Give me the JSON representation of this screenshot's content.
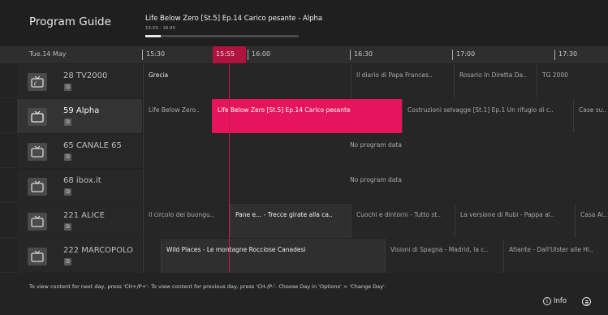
{
  "header": {
    "title": "Program Guide",
    "now_playing": {
      "title": "Life Below Zero [St.5] Ep.14 Carico pesante - Alpha",
      "time": "15:50 - 16:45",
      "progress_percent": 10
    }
  },
  "timebar": {
    "date": "Tue.14 May",
    "ticks": [
      "15:30",
      "16:00",
      "16:30",
      "17:00",
      "17:30"
    ],
    "now": "15:55"
  },
  "channels": [
    {
      "name": "28 TV2000",
      "badge": "D",
      "icon": "tv-icon",
      "programs": [
        "Grecia",
        "Il diario di Papa Frances..",
        "Rosario In Diretta Da..",
        "TG 2000"
      ]
    },
    {
      "name": "59 Alpha",
      "badge": "D",
      "icon": "tv-icon",
      "programs": [
        "Life Below Zero..",
        "Life Below Zero [St.5] Ep.14 Carico pesante",
        "Costruzioni selvagge [St.1] Ep.1 Un rifugio di c..",
        "Case su.."
      ]
    },
    {
      "name": "65 CANALE 65",
      "badge": "D",
      "icon": "tv-icon",
      "programs": [
        "No program data"
      ]
    },
    {
      "name": "68 ibox.it",
      "badge": "D",
      "icon": "tv-icon",
      "programs": [
        "No program data"
      ]
    },
    {
      "name": "221 ALICE",
      "badge": "D",
      "icon": "tv-icon",
      "programs": [
        "Il circolo dei buongu..",
        "Pane e... - Trecce girate alla ca..",
        "Cuochi e dintorni - Tutto st..",
        "La versione di Rubi - Pappa al..",
        "Casa Al.."
      ]
    },
    {
      "name": "222 MARCOPOLO",
      "badge": "D",
      "icon": "tv-icon",
      "programs": [
        "Wild Places - Le montagne Rocciose Canadesi",
        "Visioni di Spagna - Madrid, la c..",
        "Atlante - Dall'Ulster alle Hi.."
      ]
    }
  ],
  "footer": {
    "hint": "To view content for next day, press 'CH+/P+'. To view content for previous day, press 'CH-/P-'. Choose Day in 'Options' > 'Change Day'.",
    "info_label": "Info",
    "info_icon": "info-icon",
    "menu_icon": "options-icon"
  },
  "colors": {
    "accent": "#e6145c",
    "now_marker": "#b0143e",
    "background": "#232323"
  }
}
